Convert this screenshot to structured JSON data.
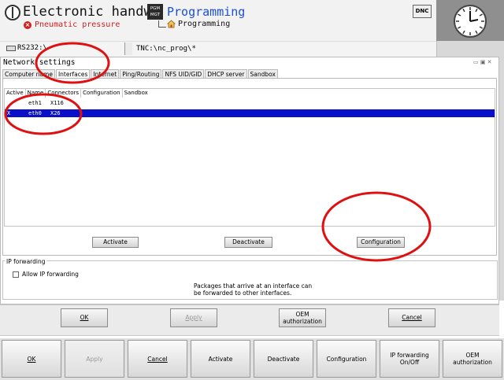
{
  "header": {
    "machine_title": "Electronic handw…",
    "error_message": "Pneumatic pressure",
    "mode_badge": "PGM\nMGT",
    "program_title": "Programming",
    "program_subtitle": "Programming",
    "dnc_label": "DNC"
  },
  "status_row": {
    "interface": "RS232:\\",
    "path": "TNC:\\nc_prog\\*"
  },
  "dialog": {
    "title": "Network settings",
    "window_controls": "▭ ▣ ✕",
    "tabs": [
      "Computer name",
      "Interfaces",
      "Internet",
      "Ping/Routing",
      "NFS UID/GID",
      "DHCP server",
      "Sandbox"
    ],
    "active_tab": "Interfaces",
    "table": {
      "headers": [
        "Active",
        "Name",
        "Connectors",
        "Configuration",
        "Sandbox"
      ],
      "rows": [
        {
          "active": "",
          "name": "eth1",
          "connectors": "X116",
          "configuration": "",
          "sandbox": ""
        },
        {
          "active": "X",
          "name": "eth0",
          "connectors": "X26",
          "configuration": "",
          "sandbox": ""
        }
      ],
      "selected_row": 1
    },
    "panel_buttons": {
      "activate": "Activate",
      "deactivate": "Deactivate",
      "configuration": "Configuration"
    },
    "ip_forwarding": {
      "group_label": "IP forwarding",
      "checkbox_label": "Allow IP forwarding",
      "checked": false,
      "note_line1": "Packages that arrive at an interface can",
      "note_line2": "be forwarded to other interfaces."
    },
    "footer_buttons": {
      "ok": "OK",
      "apply": "Apply",
      "oem_line1": "OEM",
      "oem_line2": "authorization",
      "cancel": "Cancel"
    }
  },
  "softkeys": {
    "ok": "OK",
    "apply": "Apply",
    "cancel": "Cancel",
    "activate": "Activate",
    "deactivate": "Deactivate",
    "configuration": "Configuration",
    "ipfwd_line1": "IP forwarding",
    "ipfwd_line2": "On/Off",
    "oem_line1": "OEM",
    "oem_line2": "authorization"
  },
  "colors": {
    "selection": "#0a10c8",
    "error": "#d32020",
    "program_title": "#1a4fd8",
    "annotation": "#e01010"
  }
}
